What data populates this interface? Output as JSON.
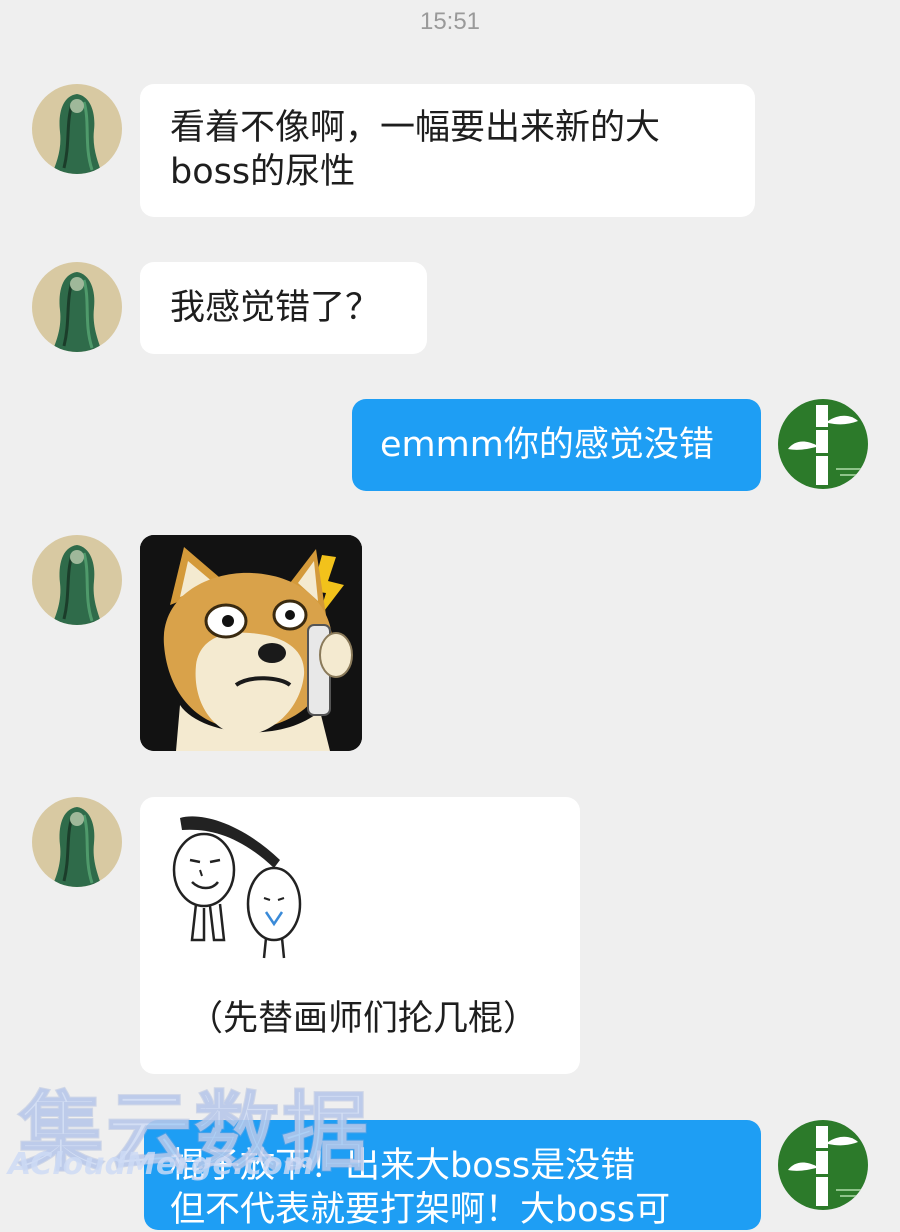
{
  "status": {
    "time": "15:51"
  },
  "messages": [
    {
      "side": "in",
      "lines": [
        "看着不像啊，一幅要出来新的大",
        "boss的尿性"
      ]
    },
    {
      "side": "in",
      "lines": [
        "我感觉错了？"
      ]
    },
    {
      "side": "out",
      "lines": [
        "emmm你的感觉没错"
      ]
    },
    {
      "side": "in",
      "sticker": "shiba-dog-phone"
    },
    {
      "side": "in",
      "meme_caption": "（先替画师们抡几棍）"
    },
    {
      "side": "out",
      "lines": [
        "棍子放下！出来大boss是没错",
        "但不代表就要打架啊！大boss可"
      ]
    }
  ],
  "watermark": {
    "main": "集云数据",
    "sub": "ACloudMerge.com"
  },
  "colors": {
    "background": "#efefef",
    "incoming_bubble": "#ffffff",
    "outgoing_bubble": "#1e9ef4"
  }
}
